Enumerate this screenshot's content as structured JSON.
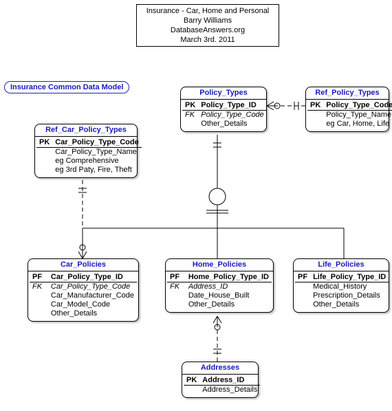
{
  "title_box": {
    "line1": "Insurance - Car, Home and Personal",
    "line2": "Barry Williams",
    "line3": "DatabaseAnswers.org",
    "line4": "March 3rd. 2011"
  },
  "model_title": "Insurance Common Data Model",
  "entities": {
    "policy_types": {
      "name": "Policy_Types",
      "rows": [
        {
          "key": "PK",
          "attr": "Policy_Type_ID",
          "pk": true
        },
        {
          "key": "FK",
          "attr": "Policy_Type_Code",
          "fk": true
        },
        {
          "key": "",
          "attr": "Other_Details"
        }
      ]
    },
    "ref_policy_types": {
      "name": "Ref_Policy_Types",
      "rows": [
        {
          "key": "PK",
          "attr": "Policy_Type_Code",
          "pk": true
        },
        {
          "key": "",
          "attr": "Policy_Type_Name"
        },
        {
          "key": "",
          "attr": "eg Car, Home, Life"
        }
      ]
    },
    "ref_car_policy_types": {
      "name": "Ref_Car_Policy_Types",
      "rows": [
        {
          "key": "PK",
          "attr": "Car_Policy_Type_Code",
          "pk": true
        },
        {
          "key": "",
          "attr": "Car_Policy_Type_Name"
        },
        {
          "key": "",
          "attr": "eg Comprehensive"
        },
        {
          "key": "",
          "attr": "eg 3rd Paty, Fire, Theft"
        }
      ]
    },
    "car_policies": {
      "name": "Car_Policies",
      "rows": [
        {
          "key": "PF",
          "attr": "Car_Policy_Type_ID",
          "pk": true
        },
        {
          "key": "FK",
          "attr": "Car_Policy_Type_Code",
          "fk": true
        },
        {
          "key": "",
          "attr": "Car_Manufacturer_Code"
        },
        {
          "key": "",
          "attr": "Car_Model_Code"
        },
        {
          "key": "",
          "attr": "Other_Details"
        }
      ]
    },
    "home_policies": {
      "name": "Home_Policies",
      "rows": [
        {
          "key": "PF",
          "attr": "Home_Policy_Type_ID",
          "pk": true
        },
        {
          "key": "FK",
          "attr": "Address_ID",
          "fk": true
        },
        {
          "key": "",
          "attr": "Date_House_Built"
        },
        {
          "key": "",
          "attr": "Other_Details"
        }
      ]
    },
    "life_policies": {
      "name": "Life_Policies",
      "rows": [
        {
          "key": "PF",
          "attr": "Life_Policy_Type_ID",
          "pk": true
        },
        {
          "key": "",
          "attr": "Medical_History"
        },
        {
          "key": "",
          "attr": "Prescription_Details"
        },
        {
          "key": "",
          "attr": "Other_Details"
        }
      ]
    },
    "addresses": {
      "name": "Addresses",
      "rows": [
        {
          "key": "PK",
          "attr": "Address_ID",
          "pk": true
        },
        {
          "key": "",
          "attr": "Address_Details"
        }
      ]
    }
  },
  "chart_data": {
    "type": "table",
    "description": "Entity-Relationship Diagram",
    "entities": [
      "Policy_Types",
      "Ref_Policy_Types",
      "Ref_Car_Policy_Types",
      "Car_Policies",
      "Home_Policies",
      "Life_Policies",
      "Addresses"
    ],
    "relationships": [
      {
        "from": "Policy_Types",
        "to": "Ref_Policy_Types",
        "type": "many-to-one",
        "identifying": false
      },
      {
        "from": "Policy_Types",
        "to": "subtype-circle",
        "type": "supertype"
      },
      {
        "from": "subtype-circle",
        "to": "Car_Policies",
        "type": "subtype"
      },
      {
        "from": "subtype-circle",
        "to": "Home_Policies",
        "type": "subtype"
      },
      {
        "from": "subtype-circle",
        "to": "Life_Policies",
        "type": "subtype"
      },
      {
        "from": "Car_Policies",
        "to": "Ref_Car_Policy_Types",
        "type": "many-to-one",
        "identifying": false
      },
      {
        "from": "Home_Policies",
        "to": "Addresses",
        "type": "many-to-one",
        "identifying": false
      }
    ]
  }
}
